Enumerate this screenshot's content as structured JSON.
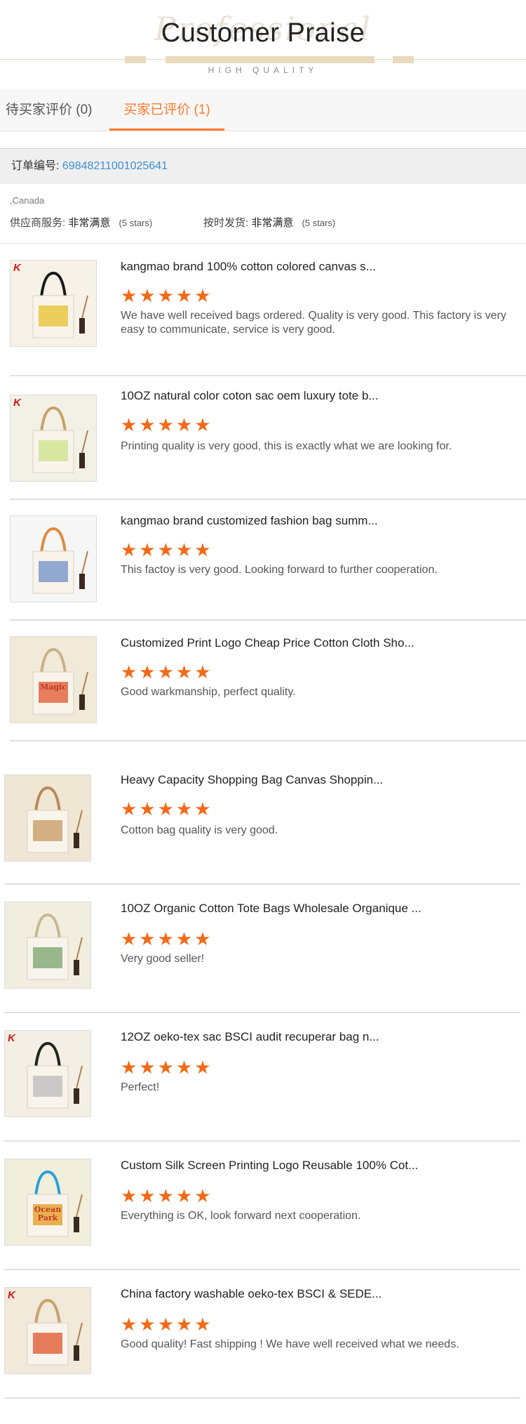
{
  "header": {
    "ghost_text": "Professional",
    "title": "Customer Praise",
    "subtitle": "HIGH QUALITY"
  },
  "tabs": [
    {
      "label": "待买家评价 (0)"
    },
    {
      "label": "买家已评价 (1)"
    }
  ],
  "order": {
    "label": "订单编号:",
    "number": "69848211001025641"
  },
  "buyer": {
    "country": ",Canada",
    "service_label": "供应商服务:",
    "service_value": "非常满意",
    "service_stars": "(5 stars)",
    "shipping_label": "按时发货:",
    "shipping_value": "非常满意",
    "shipping_stars": "(5 stars)"
  },
  "star_glyphs": "★★★★★",
  "colors": {
    "accent": "#ff7a2b",
    "star": "#f26a17",
    "order_no": "#3b8fd5",
    "brand_k": "#d01c1c"
  },
  "items": [
    {
      "title": "kangmao brand 100% cotton colored canvas s...",
      "rating": 5,
      "comment": "We have well received bags ordered. Quality is very good. This factory  is very easy to communicate, service is very good.",
      "brand_mark": "K"
    },
    {
      "title": "10OZ natural color coton sac oem luxury tote b...",
      "rating": 5,
      "comment": "Printing quality is very good, this is exactly what we are looking for.",
      "brand_mark": "K"
    },
    {
      "title": "kangmao brand customized fashion bag summ...",
      "rating": 5,
      "comment": "This factoy is very good. Looking forward to further cooperation.",
      "brand_mark": ""
    },
    {
      "title": "Customized Print Logo Cheap Price Cotton Cloth Sho...",
      "rating": 5,
      "comment": "Good warkmanship, perfect quality.",
      "brand_mark": "",
      "print": "Magic"
    },
    {
      "title": "Heavy Capacity Shopping Bag Canvas Shoppin...",
      "rating": 5,
      "comment": "Cotton bag quality is very good.",
      "brand_mark": ""
    },
    {
      "title": "10OZ Organic Cotton Tote Bags Wholesale Organique ...",
      "rating": 5,
      "comment": "Very good seller!",
      "brand_mark": ""
    },
    {
      "title": "12OZ oeko-tex sac BSCI audit recuperar bag n...",
      "rating": 5,
      "comment": "Perfect!",
      "brand_mark": "K"
    },
    {
      "title": "Custom Silk Screen Printing Logo Reusable 100% Cot...",
      "rating": 5,
      "comment": "Everything is OK, look forward next cooperation.",
      "brand_mark": "",
      "print": "Ocean Park"
    },
    {
      "title": "China factory washable oeko-tex BSCI & SEDE...",
      "rating": 5,
      "comment": "Good quality! Fast shipping ! We have well received what we needs.",
      "brand_mark": "K"
    }
  ]
}
